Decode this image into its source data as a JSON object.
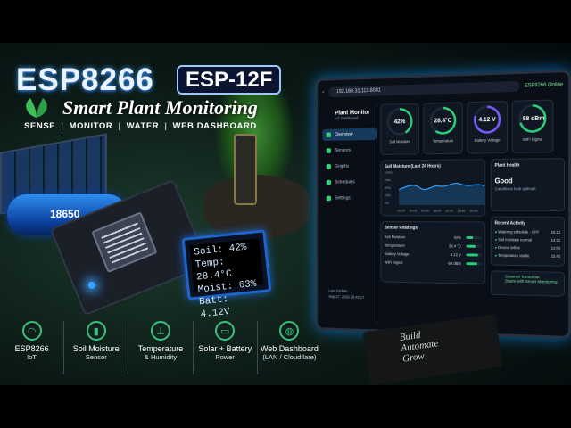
{
  "title": "ESP8266",
  "badge": "ESP-12F",
  "subtitle": "Smart Plant Monitoring",
  "tagline": [
    "SENSE",
    "MONITOR",
    "WATER",
    "WEB DASHBOARD"
  ],
  "battery_label": "18650",
  "oled_lines": [
    "Soil: 42%",
    "Temp: 28.4°C",
    "Moist: 63%",
    "Batt: 4.12V"
  ],
  "dashboard": {
    "url": "192.168.31.113:8001",
    "status": "ESP8266 Online",
    "brand": "Plant Monitor",
    "brand_sub": "IoT Dashboard",
    "nav": [
      "Overview",
      "Sensors",
      "Graphs",
      "Schedules",
      "Settings"
    ],
    "last_update_label": "Last Update",
    "last_update_value": "Sep 27, 2026  19:42:17",
    "gauges": [
      {
        "value": "42%",
        "label": "Soil Moisture",
        "color": "#2ecf7a",
        "fraction": 0.42
      },
      {
        "value": "28.4°C",
        "label": "Temperature",
        "color": "#2ecf7a",
        "fraction": 0.6
      },
      {
        "value": "4.12 V",
        "label": "Battery Voltage",
        "color": "#7b5cff",
        "fraction": 0.8
      },
      {
        "value": "-58 dBm",
        "label": "WiFi Signal",
        "color": "#2ecf7a",
        "fraction": 0.7
      }
    ],
    "chart_title": "Soil Moisture (Last 24 Hours)",
    "chart_y": [
      "100%",
      "75%",
      "50%",
      "25%",
      "0%"
    ],
    "chart_x": [
      "20:00",
      "00:00",
      "04:00",
      "08:00",
      "12:00",
      "16:00",
      "20:00"
    ],
    "health_title": "Plant Health",
    "health_value": "Good",
    "health_note": "Conditions look optimal!",
    "readings_title": "Sensor Readings",
    "readings": [
      {
        "label": "Soil Moisture",
        "value": "42%",
        "level": 0.42
      },
      {
        "label": "Temperature",
        "value": "28.4 °C",
        "level": 0.6
      },
      {
        "label": "Battery Voltage",
        "value": "4.12 V",
        "level": 0.8
      },
      {
        "label": "WiFi Signal",
        "value": "-58 dBm",
        "level": 0.7
      }
    ],
    "activity_title": "Recent Activity",
    "activity": [
      {
        "text": "Watering schedule - OFF",
        "time": "16:12"
      },
      {
        "text": "Soil moisture normal",
        "time": "14:32"
      },
      {
        "text": "Device online",
        "time": "12:05"
      },
      {
        "text": "Temperature stable",
        "time": "15:45"
      }
    ],
    "promo_line1": "Greener Tomorrow",
    "promo_line2": "Starts with Smart Monitoring"
  },
  "features": [
    {
      "icon": "wifi-icon",
      "line1": "ESP8266",
      "line2": "IoT"
    },
    {
      "icon": "soil-icon",
      "line1": "Soil Moisture",
      "line2": "Sensor"
    },
    {
      "icon": "thermometer-icon",
      "line1": "Temperature",
      "line2": "& Humidity"
    },
    {
      "icon": "battery-icon",
      "line1": "Solar + Battery",
      "line2": "Power"
    },
    {
      "icon": "globe-icon",
      "line1": "Web Dashboard",
      "line2": "(LAN / Cloudflare)"
    }
  ],
  "notebook": [
    "Build",
    "Automate",
    "Grow"
  ]
}
